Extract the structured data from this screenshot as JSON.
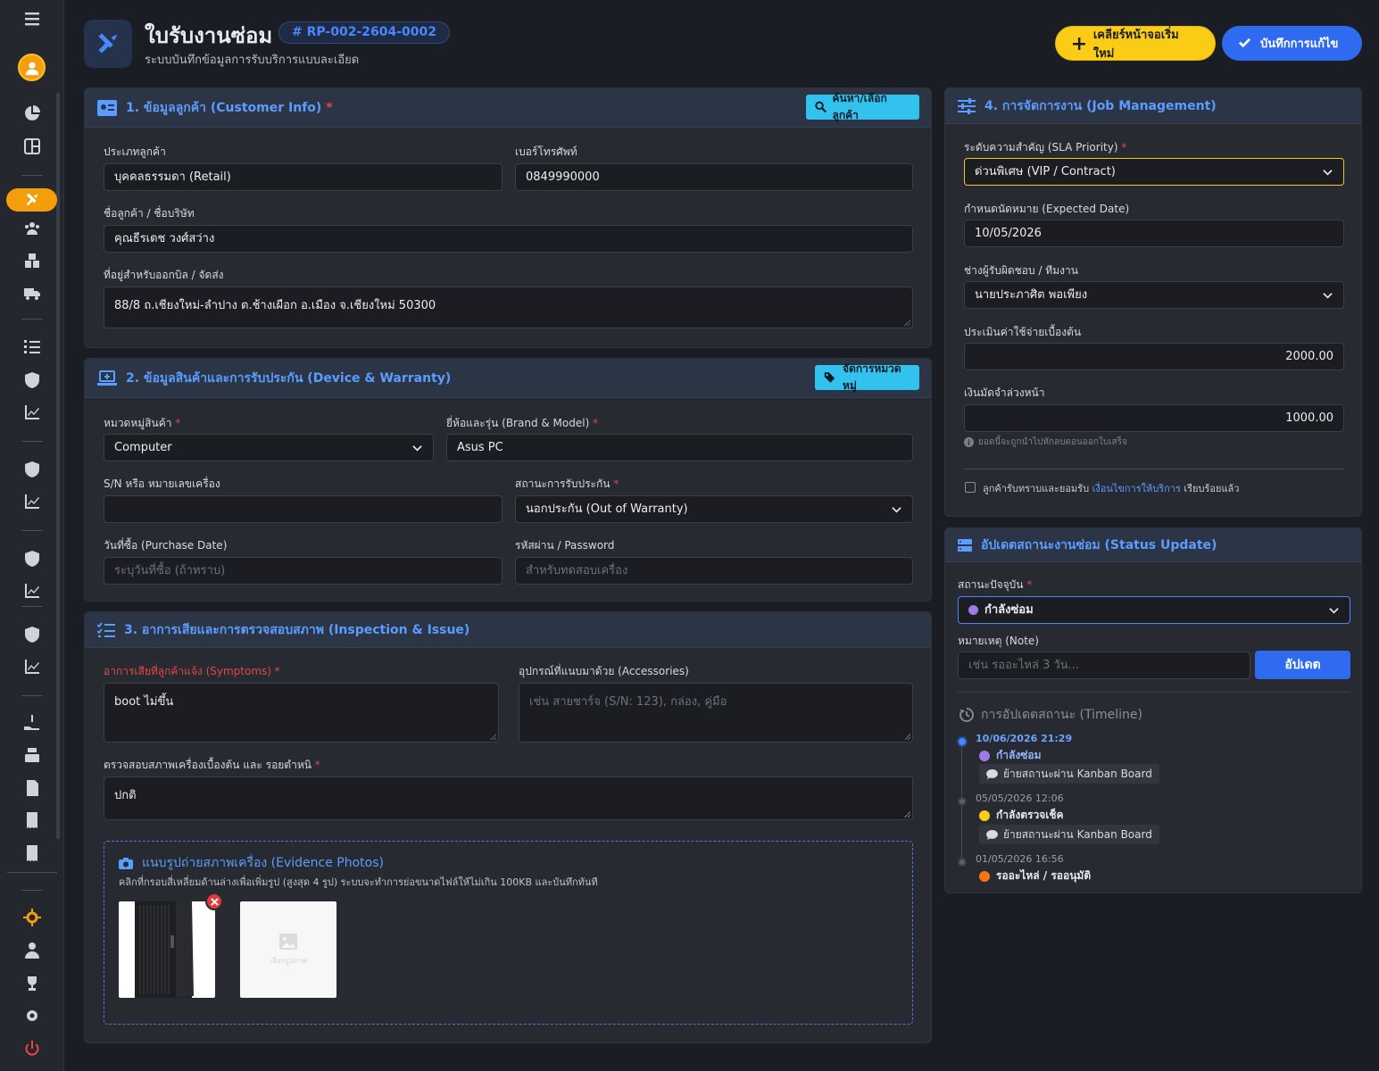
{
  "header": {
    "title": "ใบรับงานซ่อม",
    "job_no": "# RP-002-2604-0002",
    "subtitle": "ระบบบันทึกข้อมูลการรับบริการแบบละเอียด",
    "btn_clear": "เคลียร์หน้าจอเริ่มใหม่",
    "btn_save": "บันทึกการแก้ไข"
  },
  "customer": {
    "title": "1. ข้อมูลลูกค้า (Customer Info)",
    "search_btn": "ค้นหา/เลือกลูกค้า",
    "type_label": "ประเภทลูกค้า",
    "type_value": "บุคคลธรรมดา (Retail)",
    "phone_label": "เบอร์โทรศัพท์",
    "phone_value": "0849990000",
    "name_label": "ชื่อลูกค้า / ชื่อบริษัท",
    "name_value": "คุณธีรเดช วงศ์สว่าง",
    "address_label": "ที่อยู่สำหรับออกบิล / จัดส่ง",
    "address_value": "88/8 ถ.เชียงใหม่-ลำปาง ต.ช้างเผือก อ.เมือง จ.เชียงใหม่ 50300"
  },
  "device": {
    "title": "2. ข้อมูลสินค้าและการรับประกัน (Device & Warranty)",
    "category_btn": "จัดการหมวดหมู่",
    "cat_label": "หมวดหมู่สินค้า",
    "cat_value": "Computer",
    "brand_label": "ยี่ห้อและรุ่น (Brand & Model)",
    "brand_value": "Asus PC",
    "sn_label": "S/N หรือ หมายเลขเครื่อง",
    "sn_value": "",
    "warranty_label": "สถานะการรับประกัน",
    "warranty_value": "นอกประกัน (Out of Warranty)",
    "purchase_label": "วันที่ซื้อ (Purchase Date)",
    "purchase_placeholder": "ระบุวันที่ซื้อ (ถ้าทราบ)",
    "password_label": "รหัสผ่าน / Password",
    "password_placeholder": "สำหรับทดสอบเครื่อง"
  },
  "inspection": {
    "title": "3. อาการเสียและการตรวจสอบสภาพ (Inspection & Issue)",
    "symptom_label": "อาการเสียที่ลูกค้าแจ้ง (Symptoms)",
    "symptom_value": "boot ไม่ขึ้น",
    "accessory_label": "อุปกรณ์ที่แนบมาด้วย (Accessories)",
    "accessory_placeholder": "เช่น สายชาร์จ (S/N: 123), กล่อง, คู่มือ",
    "condition_label": "ตรวจสอบสภาพเครื่องเบื้องต้น และ รอยตำหนิ",
    "condition_value": "ปกติ",
    "photos_title": "แนบรูปถ่ายสภาพเครื่อง (Evidence Photos)",
    "photos_hint": "คลิกที่กรอบสี่เหลี่ยมด้านล่างเพื่อเพิ่มรูป (สูงสุด 4 รูป) ระบบจะทำการย่อขนาดไฟล์ให้ไม่เกิน 100KB และบันทึกทันที",
    "photo_add_label": "เลือกรูปภาพ"
  },
  "job": {
    "title": "4. การจัดการงาน (Job Management)",
    "sla_label": "ระดับความสำคัญ (SLA Priority)",
    "sla_value": "ด่วนพิเศษ (VIP / Contract)",
    "date_label": "กำหนดนัดหมาย (Expected Date)",
    "date_value": "10/05/2026",
    "tech_label": "ช่างผู้รับผิดชอบ / ทีมงาน",
    "tech_value": "นายประภาศิต พอเพียง",
    "cost_label": "ประเมินค่าใช้จ่ายเบื้องต้น",
    "cost_value": "2000.00",
    "deposit_label": "เงินมัดจำล่วงหน้า",
    "deposit_value": "1000.00",
    "deposit_note": "ยอดนี้จะถูกนำไปหักลบตอนออกใบเสร็จ",
    "agree_pre": "ลูกค้ารับทราบและยอมรับ",
    "agree_link": "เงื่อนไขการให้บริการ",
    "agree_post": "เรียบร้อยแล้ว"
  },
  "status": {
    "title": "อัปเดตสถานะงานซ่อม (Status Update)",
    "current_label": "สถานะปัจจุบัน",
    "current_value": "กำลังซ่อม",
    "note_label": "หมายเหตุ (Note)",
    "note_placeholder": "เช่น รออะไหล่ 3 วัน...",
    "update_btn": "อัปเดต",
    "timeline_title": "การอัปเดตสถานะ (Timeline)",
    "timeline": [
      {
        "time": "10/06/2026 21:29",
        "status": "กำลังซ่อม",
        "note": "ย้ายสถานะผ่าน Kanban Board",
        "color": "#9b7bea"
      },
      {
        "time": "05/05/2026 12:06",
        "status": "กำลังตรวจเช็ค",
        "note": "ย้ายสถานะผ่าน Kanban Board",
        "color": "#facc15"
      },
      {
        "time": "01/05/2026 16:56",
        "status": "รออะไหล่ / รออนุมัติ",
        "note": "",
        "color": "#f97316"
      }
    ]
  },
  "colors": {
    "accent": "#4a86ff",
    "warning": "#f59e0b",
    "danger": "#e04848",
    "panel": "#272a31"
  }
}
